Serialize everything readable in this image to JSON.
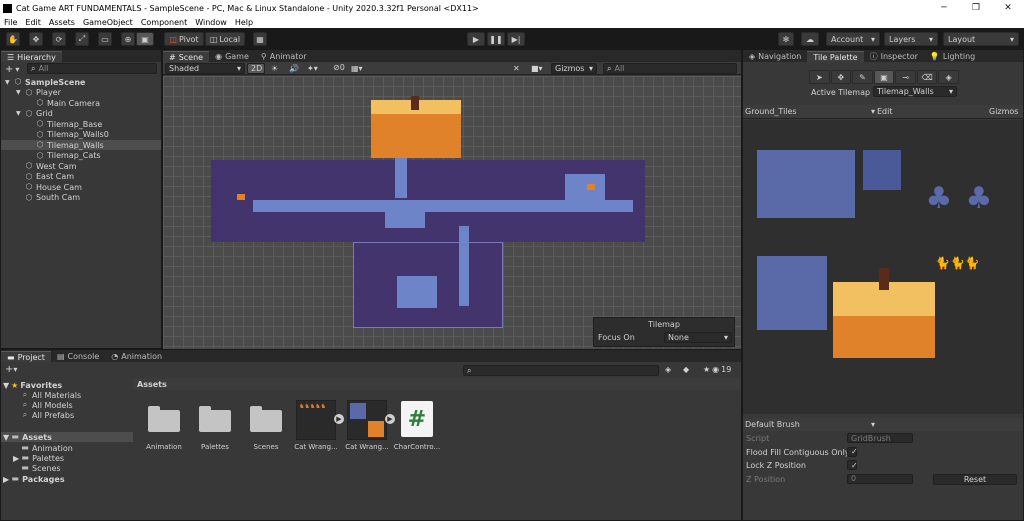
{
  "window": {
    "title": "Cat Game ART FUNDAMENTALS - SampleScene - PC, Mac & Linux Standalone - Unity 2020.3.32f1 Personal <DX11>",
    "minimize": "─",
    "maximize": "❐",
    "close": "✕"
  },
  "menu": [
    "File",
    "Edit",
    "Assets",
    "GameObject",
    "Component",
    "Window",
    "Help"
  ],
  "toolbar": {
    "pivot": "Pivot",
    "local": "Local",
    "account": "Account",
    "layers": "Layers",
    "layout": "Layout"
  },
  "hierarchy": {
    "tab": "Hierarchy",
    "add": "+",
    "search_placeholder": "All",
    "items": [
      {
        "label": "SampleScene",
        "indent": 0,
        "bold": true,
        "arrow": "▼"
      },
      {
        "label": "Player",
        "indent": 1,
        "arrow": "▼"
      },
      {
        "label": "Main Camera",
        "indent": 2,
        "arrow": ""
      },
      {
        "label": "Grid",
        "indent": 1,
        "arrow": "▼"
      },
      {
        "label": "Tilemap_Base",
        "indent": 2,
        "arrow": ""
      },
      {
        "label": "Tilemap_Walls0",
        "indent": 2,
        "arrow": ""
      },
      {
        "label": "Tilemap_Walls",
        "indent": 2,
        "arrow": "",
        "selected": true
      },
      {
        "label": "Tilemap_Cats",
        "indent": 2,
        "arrow": ""
      },
      {
        "label": "West Cam",
        "indent": 1,
        "arrow": ""
      },
      {
        "label": "East Cam",
        "indent": 1,
        "arrow": ""
      },
      {
        "label": "House Cam",
        "indent": 1,
        "arrow": ""
      },
      {
        "label": "South Cam",
        "indent": 1,
        "arrow": ""
      }
    ]
  },
  "scene": {
    "tabs": [
      "Scene",
      "Game",
      "Animator"
    ],
    "shading": "Shaded",
    "mode_2d": "2D",
    "hidden_count": "0",
    "gizmos": "Gizmos",
    "search_placeholder": "All",
    "tilemap_overlay": {
      "title": "Tilemap",
      "focus_label": "Focus On",
      "focus_value": "None"
    }
  },
  "right_panel": {
    "tabs": [
      "Navigation",
      "Tile Palette",
      "Inspector",
      "Lighting"
    ],
    "active_tilemap_label": "Active Tilemap",
    "active_tilemap_value": "Tilemap_Walls",
    "palette": "Ground_Tiles",
    "edit": "Edit",
    "gizmos": "Gizmos",
    "brush": "Default Brush",
    "props": [
      {
        "label": "Script",
        "value": "GridBrush",
        "disabled": true
      },
      {
        "label": "Flood Fill Contiguous Only",
        "value": "✓",
        "disabled": false
      },
      {
        "label": "Lock Z Position",
        "value": "✓",
        "disabled": false
      },
      {
        "label": "Z Position",
        "value": "0",
        "disabled": true
      }
    ],
    "reset": "Reset"
  },
  "project": {
    "tabs": [
      "Project",
      "Console",
      "Animation"
    ],
    "add": "+",
    "search_placeholder": "",
    "badge": "19",
    "favorites_label": "Favorites",
    "favorites": [
      "All Materials",
      "All Models",
      "All Prefabs"
    ],
    "assets_label": "Assets",
    "asset_folders": [
      "Animation",
      "Palettes",
      "Scenes"
    ],
    "packages_label": "Packages",
    "breadcrumb": "Assets",
    "items": [
      "Animation",
      "Palettes",
      "Scenes",
      "Cat Wrang...",
      "Cat Wrang...",
      "CharContro..."
    ]
  },
  "colors": {
    "floor": "#44346e",
    "path": "#6e84c8",
    "roof": "#e0822a",
    "roof_top": "#f2c060",
    "accent": "#2e7d3a"
  }
}
